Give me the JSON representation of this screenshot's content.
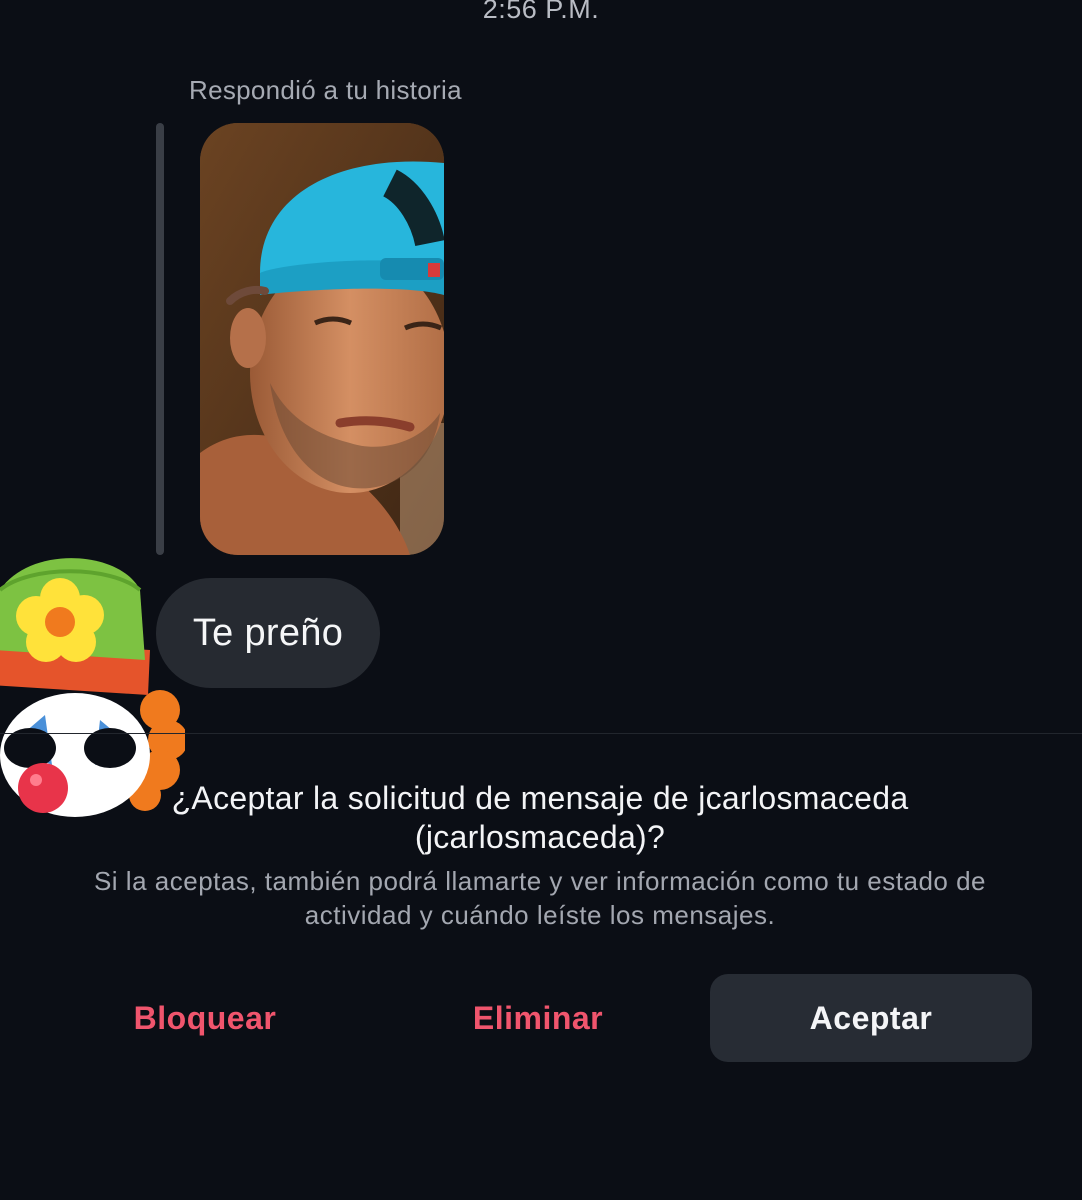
{
  "chat": {
    "timestamp": "2:56 P.M.",
    "reply_label": "Respondió a tu historia",
    "message_text": "Te preño"
  },
  "request": {
    "title": "¿Aceptar la solicitud de mensaje de jcarlosmaceda (jcarlosmaceda)?",
    "body": "Si la aceptas, también podrá llamarte y ver información como tu estado de actividad y cuándo leíste los mensajes."
  },
  "actions": {
    "block_label": "Bloquear",
    "delete_label": "Eliminar",
    "accept_label": "Aceptar"
  },
  "colors": {
    "background": "#0b0e15",
    "bubble": "#262a31",
    "danger": "#f0556d",
    "accept_button": "#272c34"
  },
  "icons": {
    "sticker": "clown-face-sticker"
  }
}
